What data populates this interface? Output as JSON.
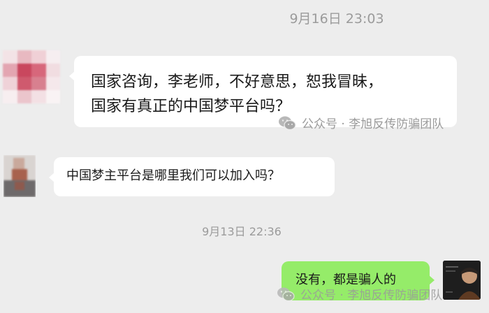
{
  "chat": {
    "timestamps": [
      "9月16日 23:03",
      "9月13日 22:36"
    ],
    "messages": [
      {
        "side": "left",
        "lines": [
          "国家咨询，李老师，不好意思，恕我冒昧，",
          "国家有真正的中国梦平台吗？"
        ]
      },
      {
        "side": "left",
        "lines": [
          "中国梦主平台是哪里我们可以加入吗？"
        ]
      },
      {
        "side": "right",
        "lines": [
          "没有，都是骗人的"
        ]
      }
    ],
    "watermark": "公众号 · 李旭反传防骗团队",
    "colors": {
      "background": "#ededed",
      "incoming_bubble": "#ffffff",
      "outgoing_bubble": "#95ec69",
      "timestamp": "#9b9b9b"
    },
    "icons": [
      "wechat-icon"
    ]
  }
}
